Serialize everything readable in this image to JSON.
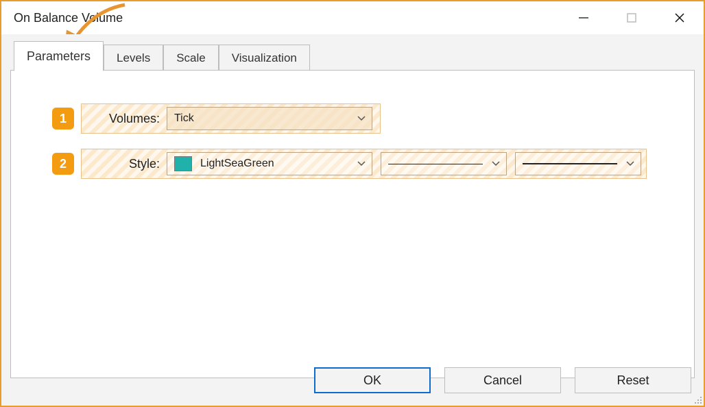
{
  "window": {
    "title": "On Balance Volume"
  },
  "tabs": {
    "parameters": "Parameters",
    "levels": "Levels",
    "scale": "Scale",
    "visualization": "Visualization"
  },
  "annotations": {
    "badge1": "1",
    "badge2": "2"
  },
  "params": {
    "volumes_label": "Volumes:",
    "volumes_value": "Tick",
    "style_label": "Style:",
    "style_color_name": "LightSeaGreen",
    "style_color_hex": "#20B2AA"
  },
  "buttons": {
    "ok": "OK",
    "cancel": "Cancel",
    "reset": "Reset"
  }
}
